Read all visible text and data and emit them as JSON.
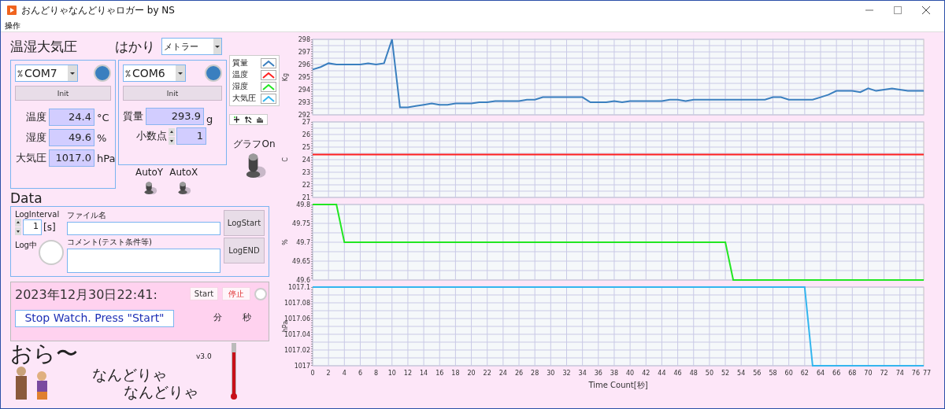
{
  "window": {
    "title": "おんどりゃなんどりゃロガー by NS"
  },
  "menu": [
    "操作"
  ],
  "sensor": {
    "title": "温湿大気圧",
    "port": "COM7",
    "connected": true,
    "init_button": "Init",
    "readings": [
      {
        "label": "温度",
        "value": "24.4",
        "unit": "°C"
      },
      {
        "label": "湿度",
        "value": "49.6",
        "unit": "%"
      },
      {
        "label": "大気圧",
        "value": "1017.0",
        "unit": "hPa"
      }
    ]
  },
  "scale": {
    "title": "はかり",
    "model": "メトラー",
    "port": "COM6",
    "connected": true,
    "init_button": "Init",
    "reading": {
      "label": "質量",
      "value": "293.9",
      "unit": "g"
    },
    "decimal": {
      "label": "小数点",
      "value": "1"
    }
  },
  "legend": [
    {
      "label": "質量",
      "color": "#3a7fbf"
    },
    {
      "label": "温度",
      "color": "#ff2020"
    },
    {
      "label": "湿度",
      "color": "#22e622"
    },
    {
      "label": "大気圧",
      "color": "#33b5ee"
    }
  ],
  "toggles": [
    {
      "label": "AutoY",
      "on": false
    },
    {
      "label": "AutoX",
      "on": false
    },
    {
      "label": "グラフOn",
      "on": true
    }
  ],
  "data": {
    "title": "Data",
    "interval_label": "LogInterval",
    "interval": "1",
    "interval_unit": "[s]",
    "file_label": "ファイル名",
    "comment_label": "コメント(テスト条件等)",
    "logging_label": "Log中",
    "logging": false,
    "buttons": [
      "LogStart",
      "LogEND"
    ]
  },
  "timer": {
    "datetime": "2023年12月30日22:41:",
    "stopwatch": "Stop Watch. Press \"Start\"",
    "start_button": "Start",
    "stop_button": "停止",
    "running": false,
    "minutes_label": "分",
    "seconds_label": "秒"
  },
  "banner": {
    "lines": [
      "おら〜",
      "なんどりゃ",
      "なんどりゃ"
    ],
    "version": "v3.0"
  },
  "charts": [
    {
      "chart_data": {
        "type": "line",
        "ylabel": "Kg",
        "grid": true,
        "ylim": [
          292,
          298
        ],
        "yticks": [
          292,
          293,
          294,
          295,
          296,
          297,
          298
        ],
        "series": [
          {
            "color": "#3a7fbf",
            "values": [
              295.6,
              295.8,
              296.1,
              296,
              296,
              296,
              296,
              296.1,
              296,
              296.1,
              298,
              292.6,
              292.6,
              292.7,
              292.8,
              292.9,
              292.8,
              292.8,
              292.9,
              292.9,
              292.9,
              293,
              293,
              293.1,
              293.1,
              293.1,
              293.1,
              293.2,
              293.2,
              293.4,
              293.4,
              293.4,
              293.4,
              293.4,
              293.4,
              293,
              293,
              293,
              293.1,
              293,
              293.1,
              293.1,
              293.1,
              293.1,
              293.1,
              293.2,
              293.2,
              293.1,
              293.2,
              293.2,
              293.2,
              293.2,
              293.2,
              293.2,
              293.2,
              293.2,
              293.2,
              293.2,
              293.4,
              293.4,
              293.2,
              293.2,
              293.2,
              293.2,
              293.4,
              293.6,
              293.9,
              293.9,
              293.9,
              293.8,
              294.1,
              293.9,
              294,
              294.1,
              294,
              293.9,
              293.9,
              293.9
            ]
          }
        ]
      }
    },
    {
      "chart_data": {
        "type": "line",
        "ylabel": "C",
        "grid": true,
        "ylim": [
          21,
          27
        ],
        "yticks": [
          21,
          22,
          23,
          24,
          25,
          26,
          27
        ],
        "series": [
          {
            "color": "#ff2020",
            "values": [
              24.4,
              24.4,
              24.4,
              24.4,
              24.4,
              24.4,
              24.4,
              24.4,
              24.4,
              24.4,
              24.4,
              24.4,
              24.4,
              24.4,
              24.4,
              24.4,
              24.4,
              24.4,
              24.4,
              24.4,
              24.4,
              24.4,
              24.4,
              24.4,
              24.4,
              24.4,
              24.4,
              24.4,
              24.4,
              24.4,
              24.4,
              24.4,
              24.4,
              24.4,
              24.4,
              24.4,
              24.4,
              24.4,
              24.4,
              24.4,
              24.4,
              24.4,
              24.4,
              24.4,
              24.4,
              24.4,
              24.4,
              24.4,
              24.4,
              24.4,
              24.4,
              24.4,
              24.4,
              24.4,
              24.4,
              24.4,
              24.4,
              24.4,
              24.4,
              24.4,
              24.4,
              24.4,
              24.4,
              24.4,
              24.4,
              24.4,
              24.4,
              24.4,
              24.4,
              24.4,
              24.4,
              24.4,
              24.4,
              24.4,
              24.4,
              24.4,
              24.4,
              24.4
            ]
          }
        ]
      }
    },
    {
      "chart_data": {
        "type": "line",
        "ylabel": "%",
        "grid": true,
        "ylim": [
          49.6,
          49.8
        ],
        "yticks": [
          49.6,
          49.65,
          49.7,
          49.75,
          49.8
        ],
        "series": [
          {
            "color": "#22e622",
            "values": [
              49.8,
              49.8,
              49.8,
              49.8,
              49.7,
              49.7,
              49.7,
              49.7,
              49.7,
              49.7,
              49.7,
              49.7,
              49.7,
              49.7,
              49.7,
              49.7,
              49.7,
              49.7,
              49.7,
              49.7,
              49.7,
              49.7,
              49.7,
              49.7,
              49.7,
              49.7,
              49.7,
              49.7,
              49.7,
              49.7,
              49.7,
              49.7,
              49.7,
              49.7,
              49.7,
              49.7,
              49.7,
              49.7,
              49.7,
              49.7,
              49.7,
              49.7,
              49.7,
              49.7,
              49.7,
              49.7,
              49.7,
              49.7,
              49.7,
              49.7,
              49.7,
              49.7,
              49.7,
              49.6,
              49.6,
              49.6,
              49.6,
              49.6,
              49.6,
              49.6,
              49.6,
              49.6,
              49.6,
              49.6,
              49.6,
              49.6,
              49.6,
              49.6,
              49.6,
              49.6,
              49.6,
              49.6,
              49.6,
              49.6,
              49.6,
              49.6,
              49.6,
              49.6
            ]
          }
        ]
      }
    },
    {
      "chart_data": {
        "type": "line",
        "ylabel": "hPa",
        "xlabel": "Time Count[秒]",
        "grid": true,
        "ylim": [
          1017,
          1017.1
        ],
        "xlim": [
          0,
          77
        ],
        "xticks": [
          0,
          2,
          4,
          6,
          8,
          10,
          12,
          14,
          16,
          18,
          20,
          22,
          24,
          26,
          28,
          30,
          32,
          34,
          36,
          38,
          40,
          42,
          44,
          46,
          48,
          50,
          52,
          54,
          56,
          58,
          60,
          62,
          64,
          66,
          68,
          70,
          72,
          74,
          76,
          77
        ],
        "x": [
          0,
          1,
          2,
          3,
          4,
          5,
          6,
          7,
          8,
          9,
          10,
          11,
          12,
          13,
          14,
          15,
          16,
          17,
          18,
          19,
          20,
          21,
          22,
          23,
          24,
          25,
          26,
          27,
          28,
          29,
          30,
          31,
          32,
          33,
          34,
          35,
          36,
          37,
          38,
          39,
          40,
          41,
          42,
          43,
          44,
          45,
          46,
          47,
          48,
          49,
          50,
          51,
          52,
          53,
          54,
          55,
          56,
          57,
          58,
          59,
          60,
          61,
          62,
          63,
          64,
          65,
          66,
          67,
          68,
          69,
          70,
          71,
          72,
          73,
          74,
          75,
          76,
          77
        ],
        "yticks": [
          {
            "value": 1017,
            "label": "1017"
          },
          {
            "value": 1017.02,
            "label": "1017.02"
          },
          {
            "value": 1017.04,
            "label": "1017.04"
          },
          {
            "value": 1017.06,
            "label": "1017.06"
          },
          {
            "value": 1017.08,
            "label": "1017.08"
          },
          {
            "value": 1017.1,
            "label": "1017.1"
          }
        ],
        "series": [
          {
            "color": "#33b5ee",
            "values": [
              1017.1,
              1017.1,
              1017.1,
              1017.1,
              1017.1,
              1017.1,
              1017.1,
              1017.1,
              1017.1,
              1017.1,
              1017.1,
              1017.1,
              1017.1,
              1017.1,
              1017.1,
              1017.1,
              1017.1,
              1017.1,
              1017.1,
              1017.1,
              1017.1,
              1017.1,
              1017.1,
              1017.1,
              1017.1,
              1017.1,
              1017.1,
              1017.1,
              1017.1,
              1017.1,
              1017.1,
              1017.1,
              1017.1,
              1017.1,
              1017.1,
              1017.1,
              1017.1,
              1017.1,
              1017.1,
              1017.1,
              1017.1,
              1017.1,
              1017.1,
              1017.1,
              1017.1,
              1017.1,
              1017.1,
              1017.1,
              1017.1,
              1017.1,
              1017.1,
              1017.1,
              1017.1,
              1017.1,
              1017.1,
              1017.1,
              1017.1,
              1017.1,
              1017.1,
              1017.1,
              1017.1,
              1017.1,
              1017.1,
              1017,
              1017,
              1017,
              1017,
              1017,
              1017,
              1017,
              1017,
              1017,
              1017,
              1017,
              1017,
              1017,
              1017,
              1017
            ]
          }
        ]
      }
    }
  ]
}
